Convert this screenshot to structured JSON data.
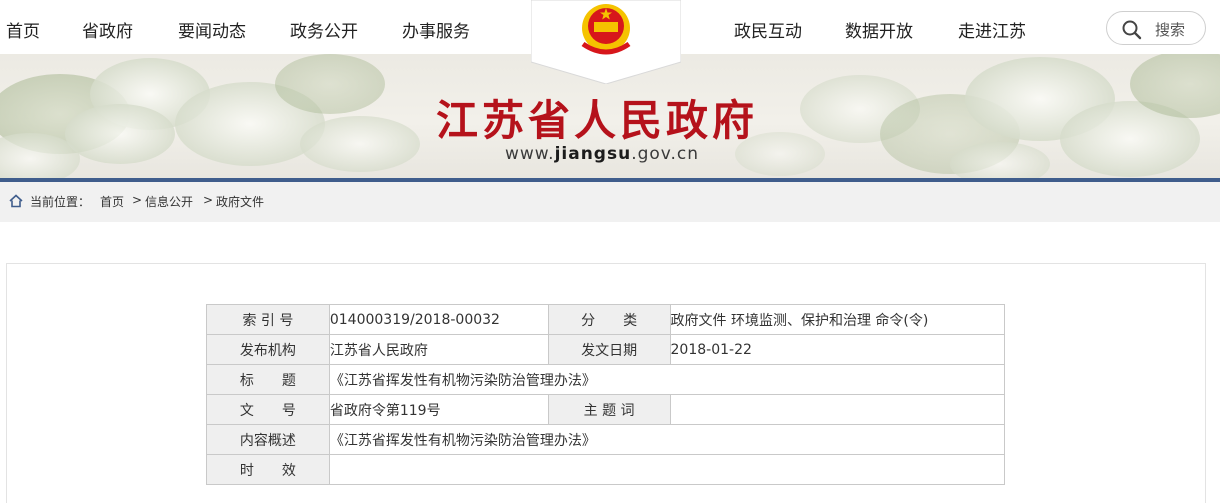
{
  "nav": {
    "left": [
      "首页",
      "省政府",
      "要闻动态",
      "政务公开",
      "办事服务"
    ],
    "right": [
      "政民互动",
      "数据开放",
      "走进江苏"
    ],
    "search_label": "搜索"
  },
  "header": {
    "title": "江苏省人民政府",
    "url_prefix": "www.",
    "url_main": "jiangsu",
    "url_suffix": ".gov.cn"
  },
  "breadcrumb": {
    "label": "当前位置：",
    "items": [
      "首页",
      "信息公开",
      "政府文件"
    ],
    "separator": ">"
  },
  "doc_meta": {
    "index_label": "索 引 号",
    "index_value": "014000319/2018-00032",
    "category_label": "分　　类",
    "category_value": "政府文件 环境监测、保护和治理 命令(令)",
    "publisher_label": "发布机构",
    "publisher_value": "江苏省人民政府",
    "date_label": "发文日期",
    "date_value": "2018-01-22",
    "title_label": "标　　题",
    "title_value": "《江苏省挥发性有机物污染防治管理办法》",
    "docno_label": "文　　号",
    "docno_value": "省政府令第119号",
    "keywords_label": "主 题 词",
    "keywords_value": "",
    "summary_label": "内容概述",
    "summary_value": "《江苏省挥发性有机物污染防治管理办法》",
    "validity_label": "时　　效",
    "validity_value": ""
  },
  "colors": {
    "title_red": "#b5121b",
    "banner_stripe": "#3f5d8c",
    "emblem_red": "#d7161b",
    "emblem_gold": "#f5c300"
  }
}
